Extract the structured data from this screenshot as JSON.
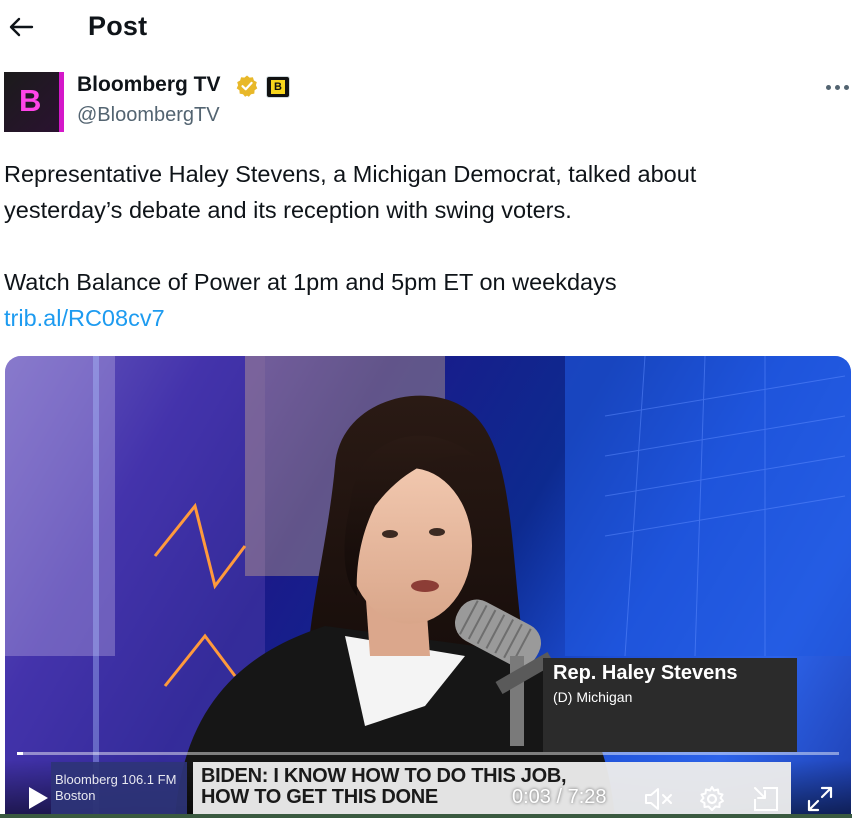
{
  "topbar": {
    "title": "Post"
  },
  "author": {
    "avatar_letter": "B",
    "display_name": "Bloomberg TV",
    "handle": "@BloombergTV",
    "org_badge_letter": "B",
    "verified_color": "#e8b829"
  },
  "tweet": {
    "line1": "Representative Haley Stevens, a Michigan Democrat, talked about",
    "line2": "yesterday’s debate and its reception with swing voters.",
    "line3": "Watch Balance of Power at 1pm and 5pm ET on weekdays",
    "link": "trib.al/RC08cv7"
  },
  "video": {
    "lower_third_name": "Rep. Haley Stevens",
    "lower_third_party": "(D) Michigan",
    "station_name": "Bloomberg 106.1 FM",
    "station_city": "Boston",
    "headline_line1": "BIDEN: I KNOW HOW TO DO THIS JOB,",
    "headline_line2": "HOW TO GET THIS DONE",
    "time_display": "0:03 / 7:28",
    "progress_fraction": 0.007,
    "link_color": "#1d9bf0"
  }
}
